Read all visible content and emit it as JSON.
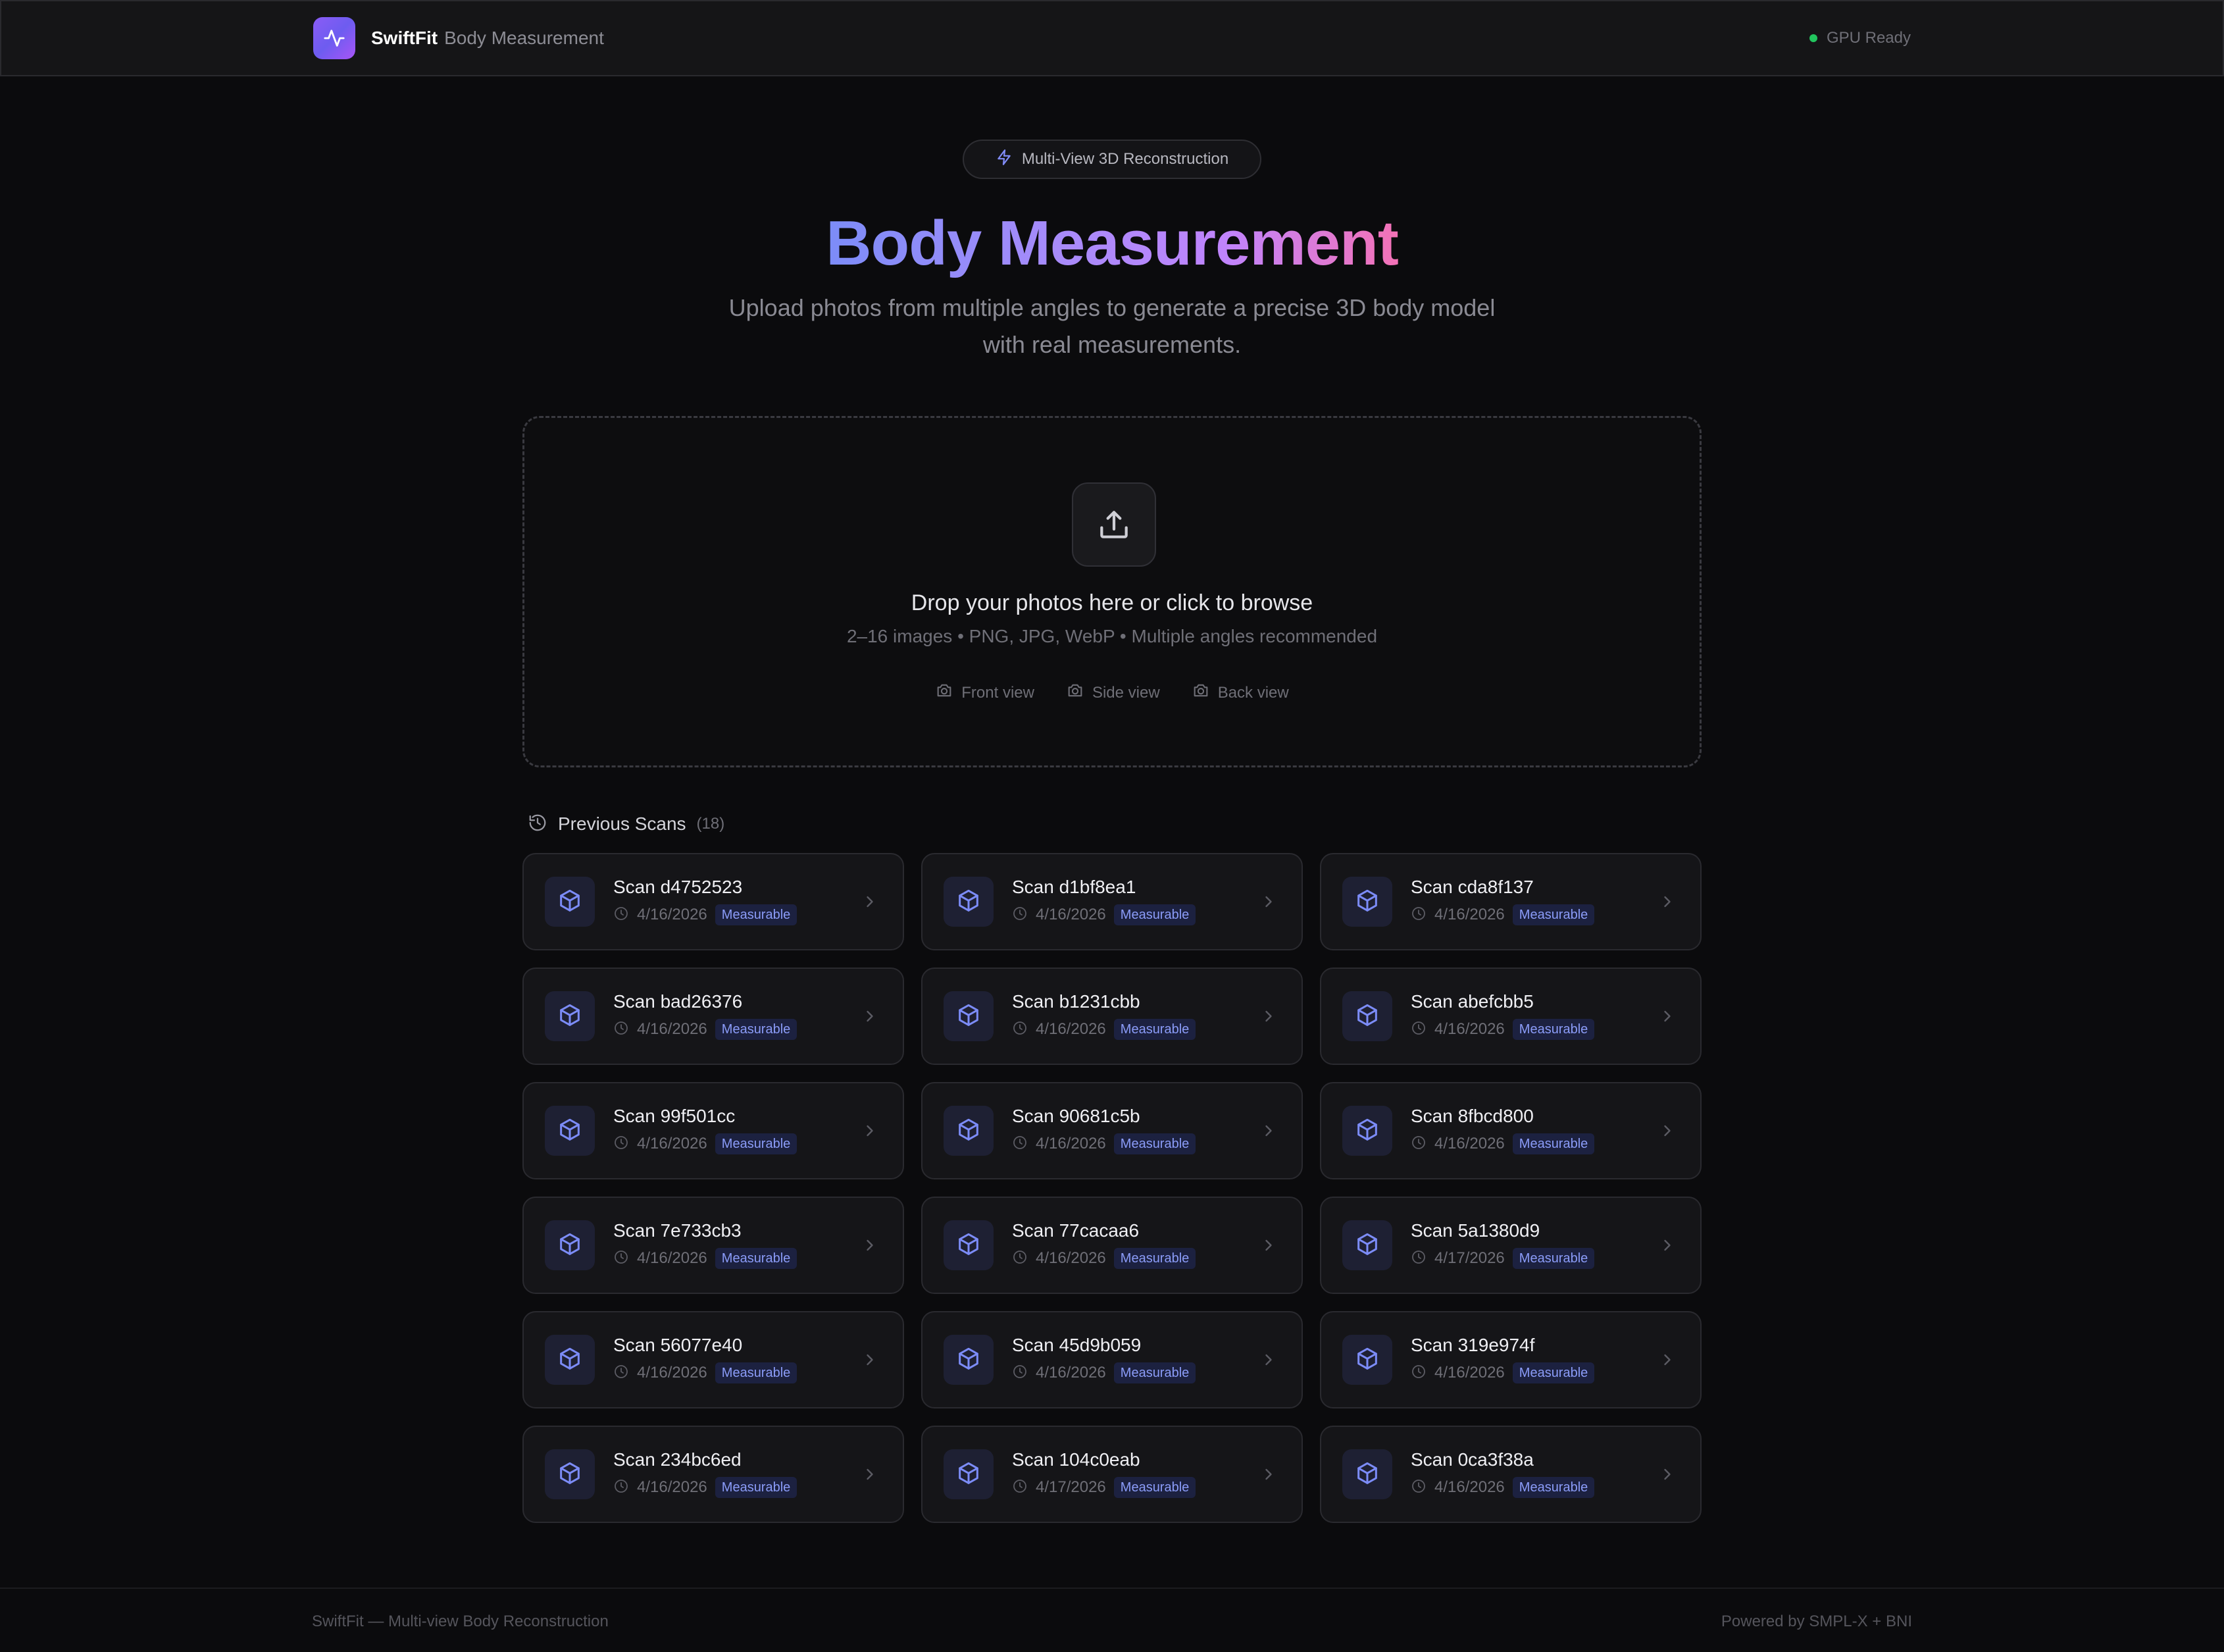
{
  "header": {
    "brand_name": "SwiftFit",
    "brand_subtitle": "Body Measurement",
    "status_text": "GPU Ready"
  },
  "hero": {
    "pill_label": "Multi-View 3D Reconstruction",
    "title": "Body Measurement",
    "subtitle": "Upload photos from multiple angles to generate a precise 3D body model with real measurements."
  },
  "dropzone": {
    "title": "Drop your photos here or click to browse",
    "hint": "2–16 images • PNG, JPG, WebP • Multiple angles recommended",
    "views": [
      "Front view",
      "Side view",
      "Back view"
    ]
  },
  "scans": {
    "title": "Previous Scans",
    "count": "(18)",
    "badge_label": "Measurable",
    "items": [
      {
        "name": "Scan d4752523",
        "date": "4/16/2026"
      },
      {
        "name": "Scan d1bf8ea1",
        "date": "4/16/2026"
      },
      {
        "name": "Scan cda8f137",
        "date": "4/16/2026"
      },
      {
        "name": "Scan bad26376",
        "date": "4/16/2026"
      },
      {
        "name": "Scan b1231cbb",
        "date": "4/16/2026"
      },
      {
        "name": "Scan abefcbb5",
        "date": "4/16/2026"
      },
      {
        "name": "Scan 99f501cc",
        "date": "4/16/2026"
      },
      {
        "name": "Scan 90681c5b",
        "date": "4/16/2026"
      },
      {
        "name": "Scan 8fbcd800",
        "date": "4/16/2026"
      },
      {
        "name": "Scan 7e733cb3",
        "date": "4/16/2026"
      },
      {
        "name": "Scan 77cacaa6",
        "date": "4/16/2026"
      },
      {
        "name": "Scan 5a1380d9",
        "date": "4/17/2026"
      },
      {
        "name": "Scan 56077e40",
        "date": "4/16/2026"
      },
      {
        "name": "Scan 45d9b059",
        "date": "4/16/2026"
      },
      {
        "name": "Scan 319e974f",
        "date": "4/16/2026"
      },
      {
        "name": "Scan 234bc6ed",
        "date": "4/16/2026"
      },
      {
        "name": "Scan 104c0eab",
        "date": "4/17/2026"
      },
      {
        "name": "Scan 0ca3f38a",
        "date": "4/16/2026"
      }
    ]
  },
  "footer": {
    "left": "SwiftFit — Multi-view Body Reconstruction",
    "right": "Powered by SMPL-X + BNI"
  },
  "colors": {
    "background": "#0b0b0d",
    "accent": "#8b5cf6",
    "badge_text": "#8b9cf8",
    "status_ok": "#22c55e"
  },
  "icons": [
    "activity-icon",
    "zap-icon",
    "upload-icon",
    "camera-icon",
    "history-icon",
    "cube-icon",
    "clock-icon",
    "chevron-right-icon"
  ]
}
